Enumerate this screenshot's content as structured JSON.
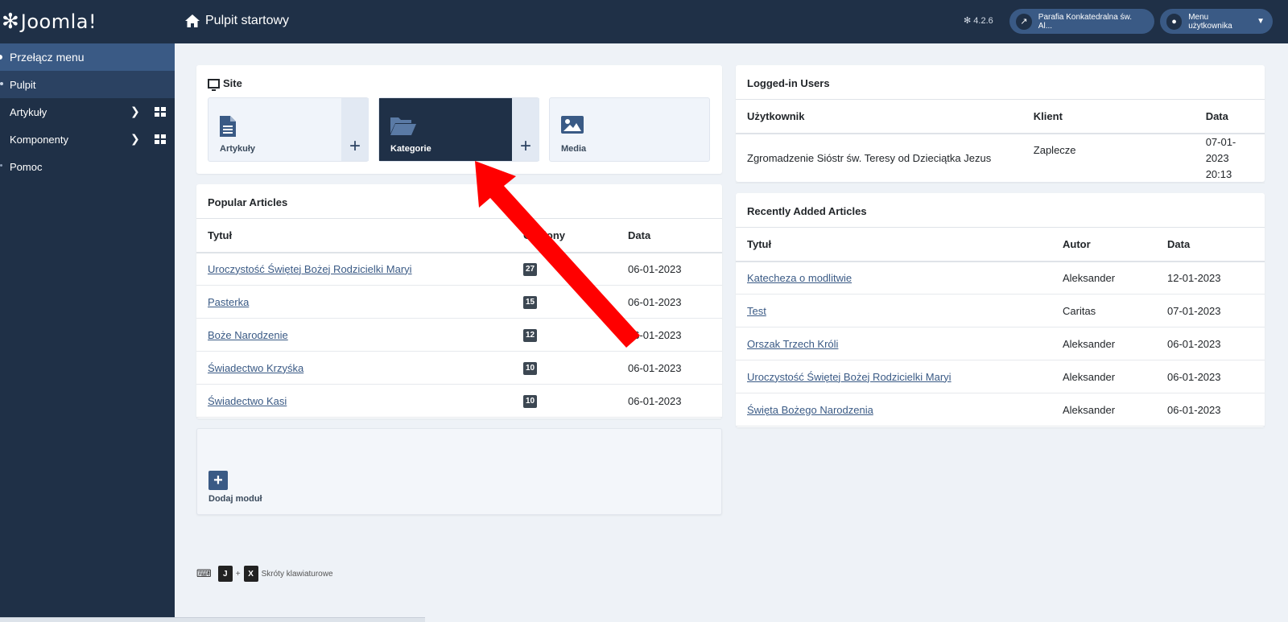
{
  "brand": {
    "logo_text": "Joomla!"
  },
  "sidebar": {
    "items": [
      {
        "label": "Przełącz menu"
      },
      {
        "label": "Pulpit"
      },
      {
        "label": "Artykuły"
      },
      {
        "label": "Komponenty"
      },
      {
        "label": "Pomoc"
      }
    ]
  },
  "header": {
    "title": "Pulpit startowy",
    "version": "4.2.6",
    "site_link": "Parafia Konkatedralna św. Al...",
    "user_menu": "Menu użytkownika"
  },
  "site_card": {
    "title": "Site",
    "tiles": [
      {
        "label": "Artykuły",
        "add": "+"
      },
      {
        "label": "Kategorie",
        "add": "+"
      },
      {
        "label": "Media"
      }
    ]
  },
  "popular": {
    "title": "Popular Articles",
    "columns": [
      "Tytuł",
      "Odsłony",
      "Data"
    ],
    "rows": [
      {
        "title": "Uroczystość Świętej Bożej Rodzicielki Maryi",
        "hits": "27",
        "date": "06-01-2023"
      },
      {
        "title": "Pasterka",
        "hits": "15",
        "date": "06-01-2023"
      },
      {
        "title": "Boże Narodzenie",
        "hits": "12",
        "date": "06-01-2023"
      },
      {
        "title": "Świadectwo Krzyśka",
        "hits": "10",
        "date": "06-01-2023"
      },
      {
        "title": "Świadectwo Kasi",
        "hits": "10",
        "date": "06-01-2023"
      }
    ]
  },
  "add_module": {
    "label": "Dodaj moduł"
  },
  "logged_in": {
    "title": "Logged-in Users",
    "columns": [
      "Użytkownik",
      "Klient",
      "Data"
    ],
    "rows": [
      {
        "user": "Zgromadzenie Sióstr św. Teresy od Dzieciątka Jezus",
        "client": "Zaplecze",
        "date": "07-01-2023 20:13"
      }
    ]
  },
  "recent": {
    "title": "Recently Added Articles",
    "columns": [
      "Tytuł",
      "Autor",
      "Data"
    ],
    "rows": [
      {
        "title": "Katecheza o modlitwie",
        "author": "Aleksander",
        "date": "12-01-2023"
      },
      {
        "title": "Test",
        "author": "Caritas",
        "date": "07-01-2023"
      },
      {
        "title": "Orszak Trzech Króli",
        "author": "Aleksander",
        "date": "06-01-2023"
      },
      {
        "title": "Uroczystość Świętej Bożej Rodzicielki Maryi",
        "author": "Aleksander",
        "date": "06-01-2023"
      },
      {
        "title": "Święta Bożego Narodzenia",
        "author": "Aleksander",
        "date": "06-01-2023"
      }
    ]
  },
  "shortcuts": {
    "key1": "J",
    "plus": "+",
    "key2": "X",
    "label": "Skróty klawiaturowe"
  },
  "colors": {
    "sidebar": "#1f3047",
    "accent": "#3a5a85",
    "arrow": "#ff0000"
  }
}
